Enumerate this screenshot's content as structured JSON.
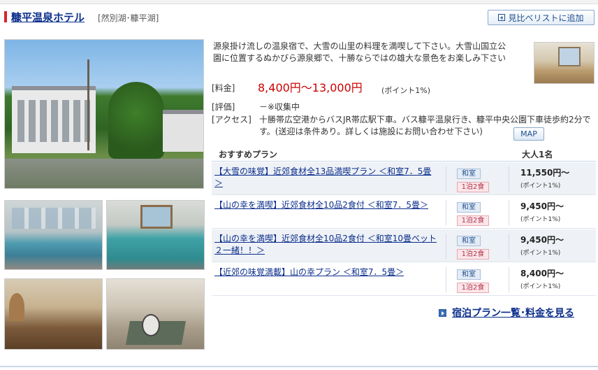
{
  "header": {
    "hotel_name": "糠平温泉ホテル",
    "area": "[然別湖･糠平湖]",
    "compare_button": "見比べリストに追加"
  },
  "info": {
    "description": "源泉掛け流しの温泉宿で、大雪の山里の料理を満喫して下さい。大雪山国立公園に位置するぬかびら源泉郷で、十勝ならではの雄大な景色をお楽しみ下さい",
    "price_label": "[料金]",
    "price_value": "8,400円〜13,000円",
    "price_point": "(ポイント1%)",
    "rating_label": "[評価]",
    "rating_value": "－※収集中",
    "access_label": "[アクセス]",
    "access_value": "十勝帯広空港からバスJR帯広駅下車。バス糠平温泉行き、糠平中央公園下車徒歩約2分です。(送迎は条件あり。詳しくは施設にお問い合わせ下さい)",
    "map_button": "MAP"
  },
  "plans": {
    "header_plan": "おすすめプラン",
    "header_price": "大人1名",
    "rows": [
      {
        "name": "【大雪の味覚】近郊食材全13品満喫プラン ＜和室7．5畳＞",
        "room": "和室",
        "meal": "1泊2食",
        "price": "11,550円〜",
        "point": "(ポイント1%)"
      },
      {
        "name": "【山の幸を満喫】近郊食材全10品2食付 ＜和室7．5畳＞",
        "room": "和室",
        "meal": "1泊2食",
        "price": "9,450円〜",
        "point": "(ポイント1%)"
      },
      {
        "name": "【山の幸を満喫】近郊食材全10品2食付 ＜和室10畳ベット２一緒！！＞",
        "room": "和室",
        "meal": "1泊2食",
        "price": "9,450円〜",
        "point": "(ポイント1%)"
      },
      {
        "name": "【近郊の味覚満載】山の幸プラン ＜和室7．5畳＞",
        "room": "和室",
        "meal": "1泊2食",
        "price": "8,400円〜",
        "point": "(ポイント1%)"
      }
    ],
    "list_link": "宿泊プラン一覧･料金を見る"
  },
  "colors": {
    "link": "#0b2e8c",
    "price_red": "#cc0000",
    "accent_bar": "#d8232a",
    "row_alt": "#eef1f5"
  }
}
